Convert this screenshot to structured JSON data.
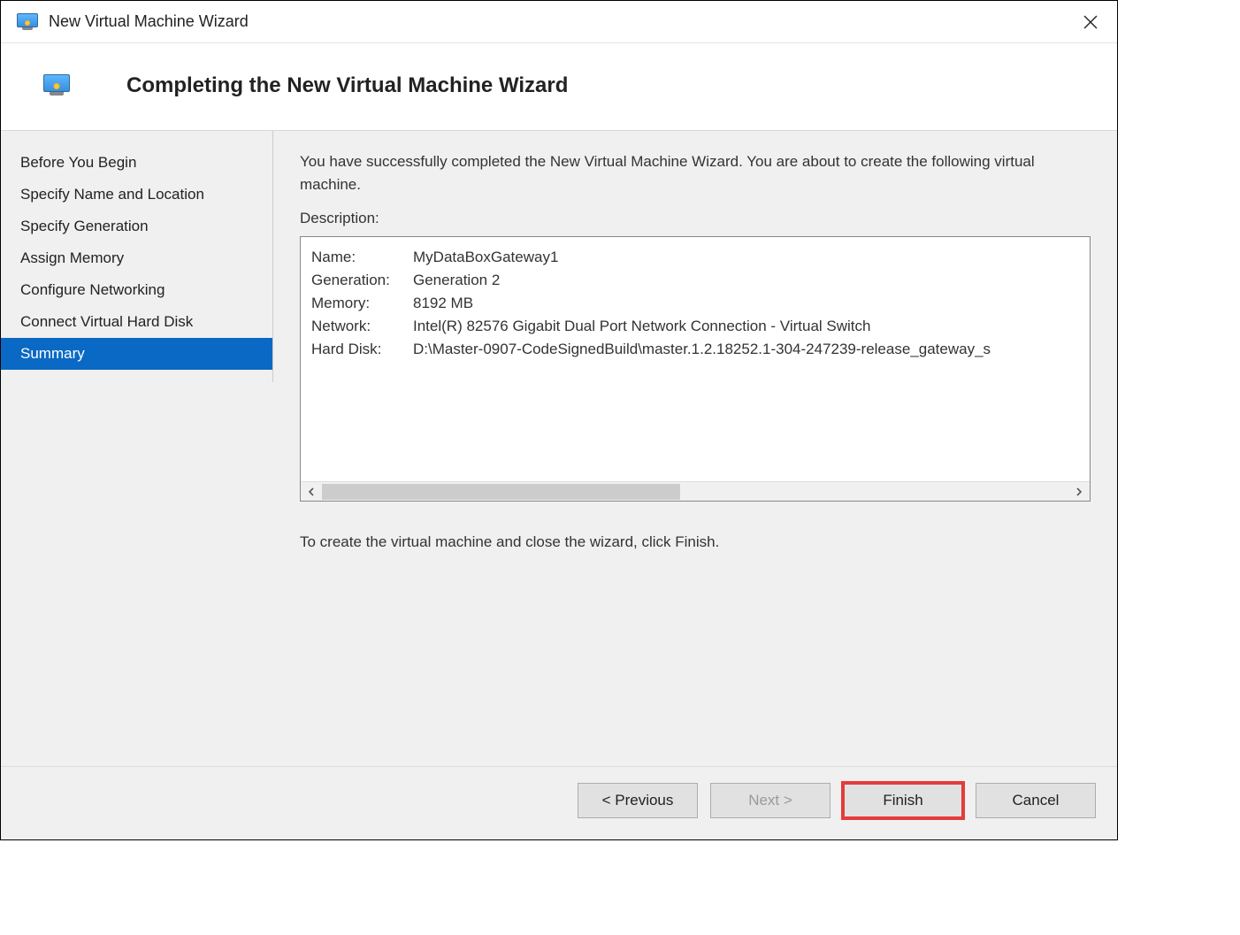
{
  "window": {
    "title": "New Virtual Machine Wizard"
  },
  "header": {
    "page_title": "Completing the New Virtual Machine Wizard"
  },
  "sidebar": {
    "steps": [
      {
        "label": "Before You Begin"
      },
      {
        "label": "Specify Name and Location"
      },
      {
        "label": "Specify Generation"
      },
      {
        "label": "Assign Memory"
      },
      {
        "label": "Configure Networking"
      },
      {
        "label": "Connect Virtual Hard Disk"
      },
      {
        "label": "Summary"
      }
    ],
    "active_index": 6
  },
  "content": {
    "intro": "You have successfully completed the New Virtual Machine Wizard. You are about to create the following virtual machine.",
    "description_label": "Description:",
    "summary": [
      {
        "key": "Name:",
        "value": "MyDataBoxGateway1"
      },
      {
        "key": "Generation:",
        "value": "Generation 2"
      },
      {
        "key": "Memory:",
        "value": "8192 MB"
      },
      {
        "key": "Network:",
        "value": "Intel(R) 82576 Gigabit Dual Port Network Connection - Virtual Switch"
      },
      {
        "key": "Hard Disk:",
        "value": "D:\\Master-0907-CodeSignedBuild\\master.1.2.18252.1-304-247239-release_gateway_s"
      }
    ],
    "closing": "To create the virtual machine and close the wizard, click Finish."
  },
  "footer": {
    "previous": "< Previous",
    "next": "Next >",
    "finish": "Finish",
    "cancel": "Cancel"
  }
}
